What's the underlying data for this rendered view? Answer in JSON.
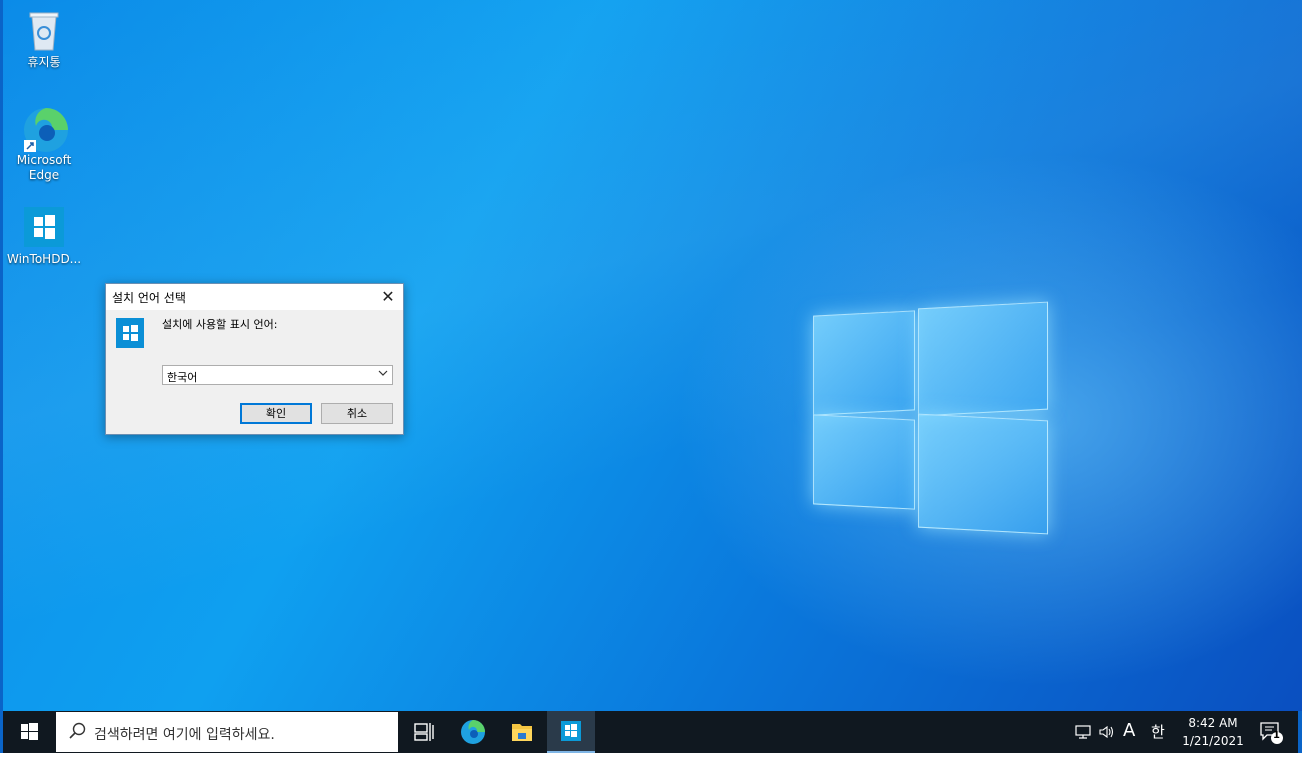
{
  "desktop": {
    "icons": [
      {
        "label": "휴지통"
      },
      {
        "label": "Microsoft Edge"
      },
      {
        "label": "WinToHDD..."
      }
    ]
  },
  "dialog": {
    "title": "설치 언어 선택",
    "close_label": "✕",
    "prompt": "설치에 사용할 표시 언어:",
    "language_value": "한국어",
    "ok_label": "확인",
    "cancel_label": "취소"
  },
  "taskbar": {
    "search_placeholder": "검색하려면 여기에 입력하세요.",
    "tray": {
      "ime_a": "A",
      "ime_han": "한",
      "time": "8:42 AM",
      "date": "1/21/2021",
      "notification_count": "1"
    }
  },
  "colors": {
    "accent": "#0078d7",
    "taskbar_bg": "#101820",
    "dialog_bg": "#f0f0f0"
  }
}
